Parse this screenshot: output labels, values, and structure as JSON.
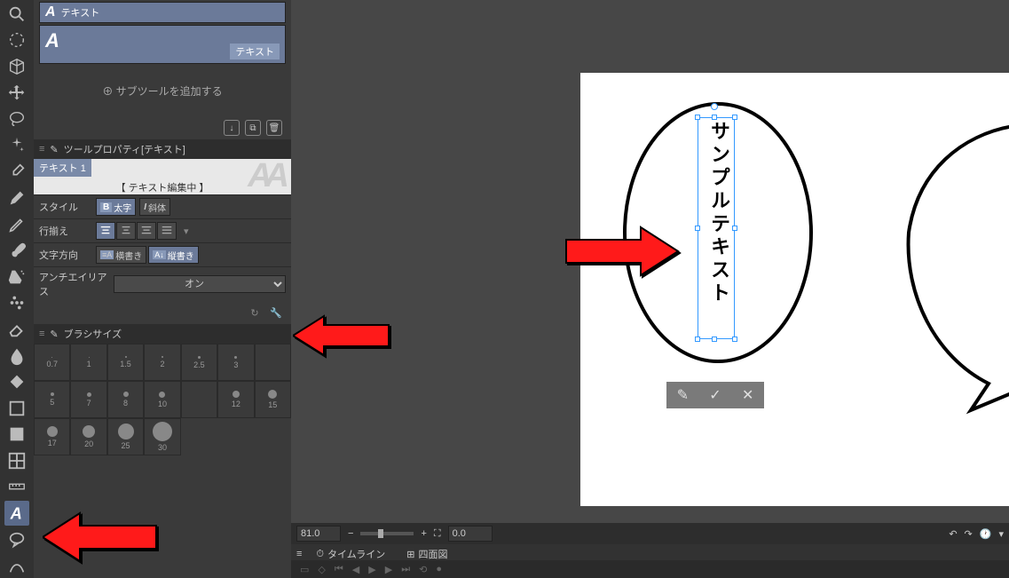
{
  "subtool": {
    "header_label": "テキスト",
    "item_label": "テキスト",
    "add_label": "サブツールを追加する"
  },
  "tool_property": {
    "panel_title": "ツールプロパティ[テキスト]",
    "tab_label": "テキスト 1",
    "editing_label": "【 テキスト編集中 】",
    "style_label": "スタイル",
    "bold_label": "太字",
    "italic_label": "斜体",
    "align_label": "行揃え",
    "direction_label": "文字方向",
    "horizontal_label": "横書き",
    "vertical_label": "縦書き",
    "aa_label": "アンチエイリアス",
    "aa_value": "オン"
  },
  "brush": {
    "panel_title": "ブラシサイズ",
    "sizes": [
      "0.7",
      "1",
      "1.5",
      "2",
      "2.5",
      "3",
      "",
      "5",
      "7",
      "8",
      "10",
      "",
      "12",
      "15",
      "17",
      "20",
      "25",
      "30"
    ]
  },
  "canvas": {
    "sample_text": "サンプルテキスト"
  },
  "bottom": {
    "zoom": "81.0",
    "rotation": "0.0"
  },
  "timeline": {
    "tab1": "タイムライン",
    "tab2": "四面図"
  }
}
